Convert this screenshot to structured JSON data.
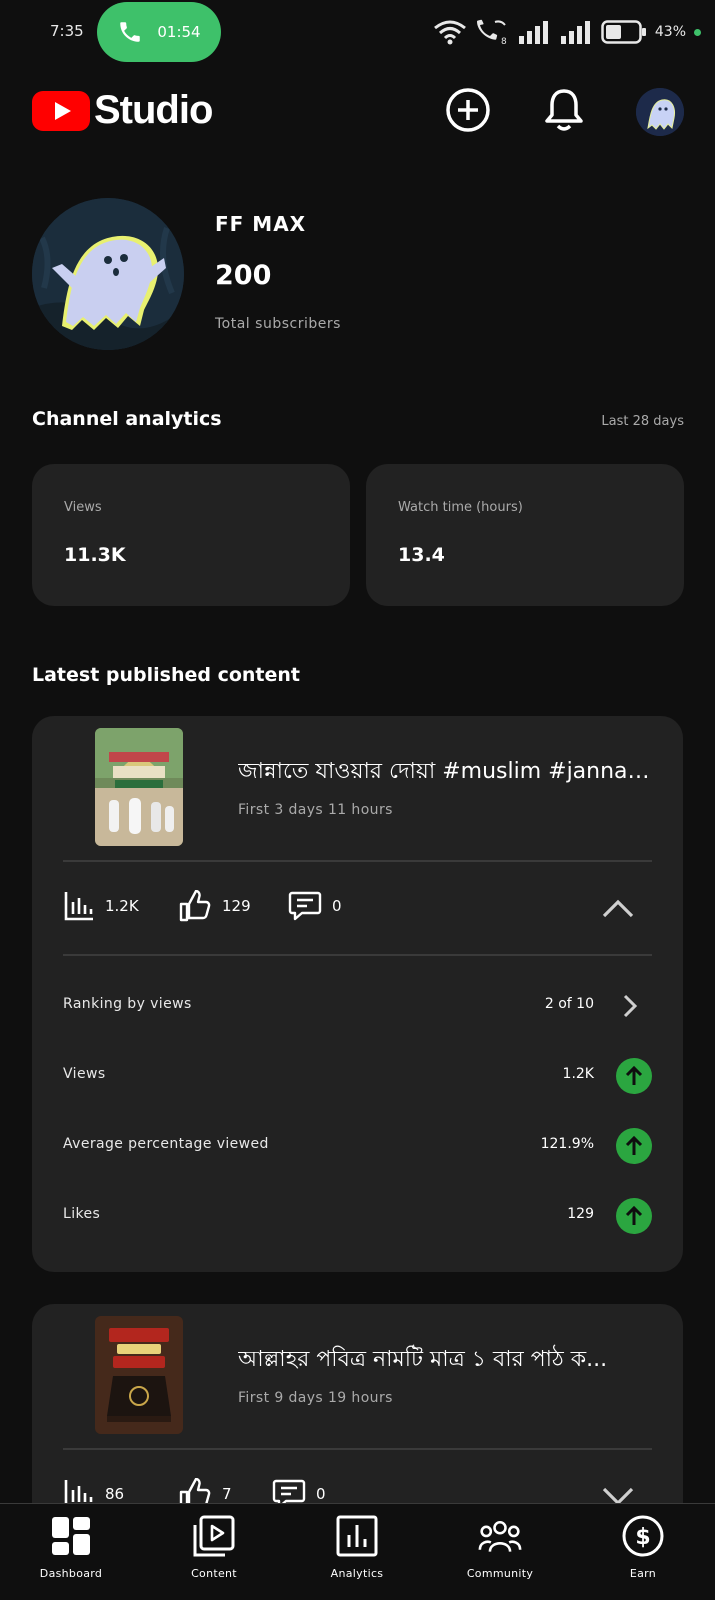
{
  "status_bar": {
    "time": "7:35",
    "call_timer": "01:54",
    "battery": "43%"
  },
  "header": {
    "app_name": "Studio",
    "icons": [
      "create-icon",
      "notifications-icon",
      "account-avatar"
    ]
  },
  "channel": {
    "name": "FF MAX",
    "subscriber_count": "200",
    "subscriber_label": "Total subscribers"
  },
  "analytics": {
    "title": "Channel analytics",
    "period": "Last 28 days",
    "cards": [
      {
        "label": "Views",
        "value": "11.3K"
      },
      {
        "label": "Watch time (hours)",
        "value": "13.4"
      }
    ]
  },
  "latest": {
    "title": "Latest published content",
    "items": [
      {
        "title": "জান্নাতে যাওয়ার দোয়া #muslim #jannat #dua...",
        "age": "First 3 days 11 hours",
        "views": "1.2K",
        "likes": "129",
        "comments": "0",
        "expanded": true,
        "details": [
          {
            "label": "Ranking by views",
            "value": "2 of 10",
            "indicator": "chevron-right"
          },
          {
            "label": "Views",
            "value": "1.2K",
            "indicator": "up"
          },
          {
            "label": "Average percentage viewed",
            "value": "121.9%",
            "indicator": "up"
          },
          {
            "label": "Likes",
            "value": "129",
            "indicator": "up"
          }
        ]
      },
      {
        "title": "আল্লাহর পবিত্র নামটি মাত্র ১ বার পাঠ ক...",
        "age": "First 9 days 19 hours",
        "views": "86",
        "likes": "7",
        "comments": "0",
        "expanded": false
      }
    ]
  },
  "nav": {
    "items": [
      {
        "label": "Dashboard",
        "icon": "dashboard-icon"
      },
      {
        "label": "Content",
        "icon": "content-icon"
      },
      {
        "label": "Analytics",
        "icon": "analytics-icon"
      },
      {
        "label": "Community",
        "icon": "community-icon"
      },
      {
        "label": "Earn",
        "icon": "earn-icon"
      }
    ]
  },
  "colors": {
    "background": "#0f0f0f",
    "card": "#222222",
    "brand_red": "#ff0000",
    "up_green": "#2ba640",
    "call_green": "#3ec16a"
  }
}
